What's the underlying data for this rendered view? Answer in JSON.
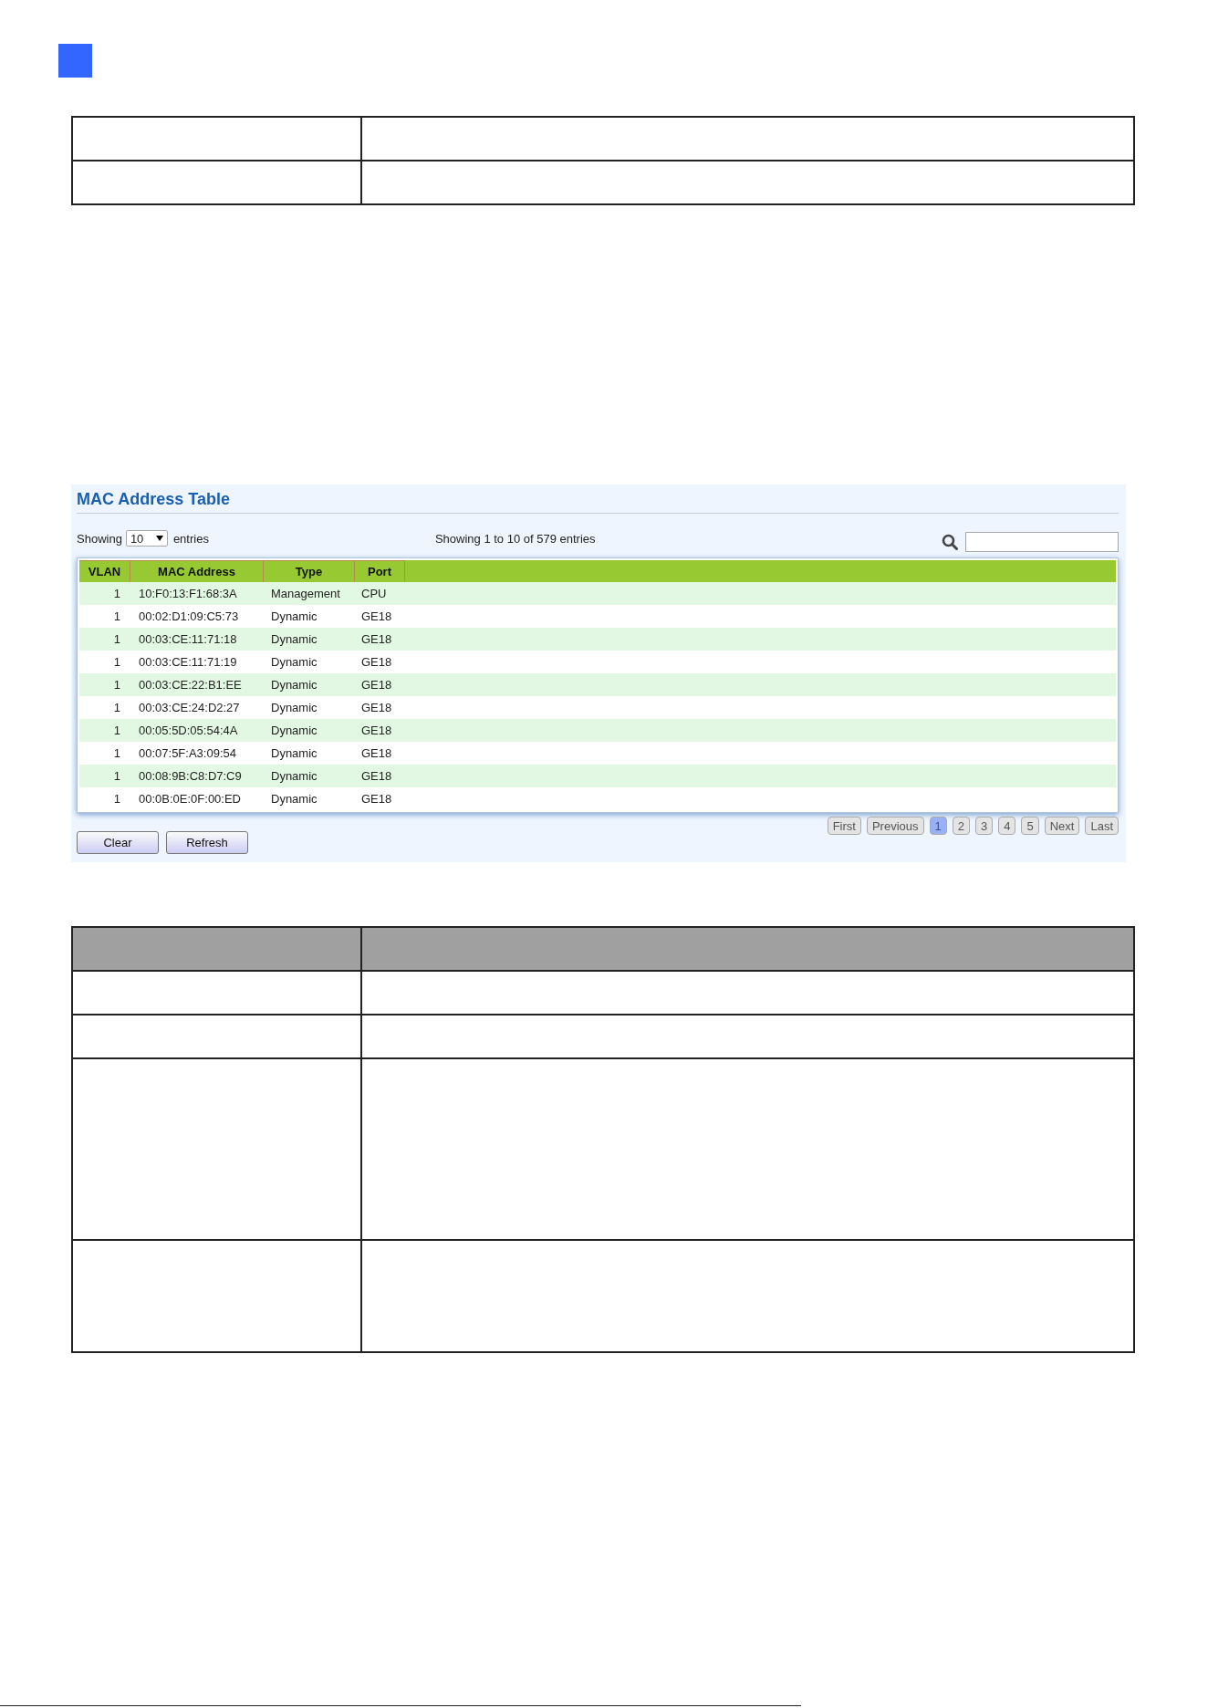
{
  "panel": {
    "title": "MAC Address Table",
    "length_label_before": "Showing",
    "page_size": "10",
    "length_label_after": "entries",
    "info": "Showing 1 to 10 of 579 entries",
    "table": {
      "columns": [
        "VLAN",
        "MAC Address",
        "Type",
        "Port"
      ],
      "rows": [
        [
          "1",
          "10:F0:13:F1:68:3A",
          "Management",
          "CPU"
        ],
        [
          "1",
          "00:02:D1:09:C5:73",
          "Dynamic",
          "GE18"
        ],
        [
          "1",
          "00:03:CE:11:71:18",
          "Dynamic",
          "GE18"
        ],
        [
          "1",
          "00:03:CE:11:71:19",
          "Dynamic",
          "GE18"
        ],
        [
          "1",
          "00:03:CE:22:B1:EE",
          "Dynamic",
          "GE18"
        ],
        [
          "1",
          "00:03:CE:24:D2:27",
          "Dynamic",
          "GE18"
        ],
        [
          "1",
          "00:05:5D:05:54:4A",
          "Dynamic",
          "GE18"
        ],
        [
          "1",
          "00:07:5F:A3:09:54",
          "Dynamic",
          "GE18"
        ],
        [
          "1",
          "00:08:9B:C8:D7:C9",
          "Dynamic",
          "GE18"
        ],
        [
          "1",
          "00:0B:0E:0F:00:ED",
          "Dynamic",
          "GE18"
        ]
      ]
    },
    "pagination": [
      {
        "label": "First",
        "selected": false
      },
      {
        "label": "Previous",
        "selected": false
      },
      {
        "label": "1",
        "selected": true
      },
      {
        "label": "2",
        "selected": false
      },
      {
        "label": "3",
        "selected": false
      },
      {
        "label": "4",
        "selected": false
      },
      {
        "label": "5",
        "selected": false
      },
      {
        "label": "Next",
        "selected": false
      },
      {
        "label": "Last",
        "selected": false
      }
    ],
    "buttons": [
      "Clear",
      "Refresh"
    ]
  }
}
